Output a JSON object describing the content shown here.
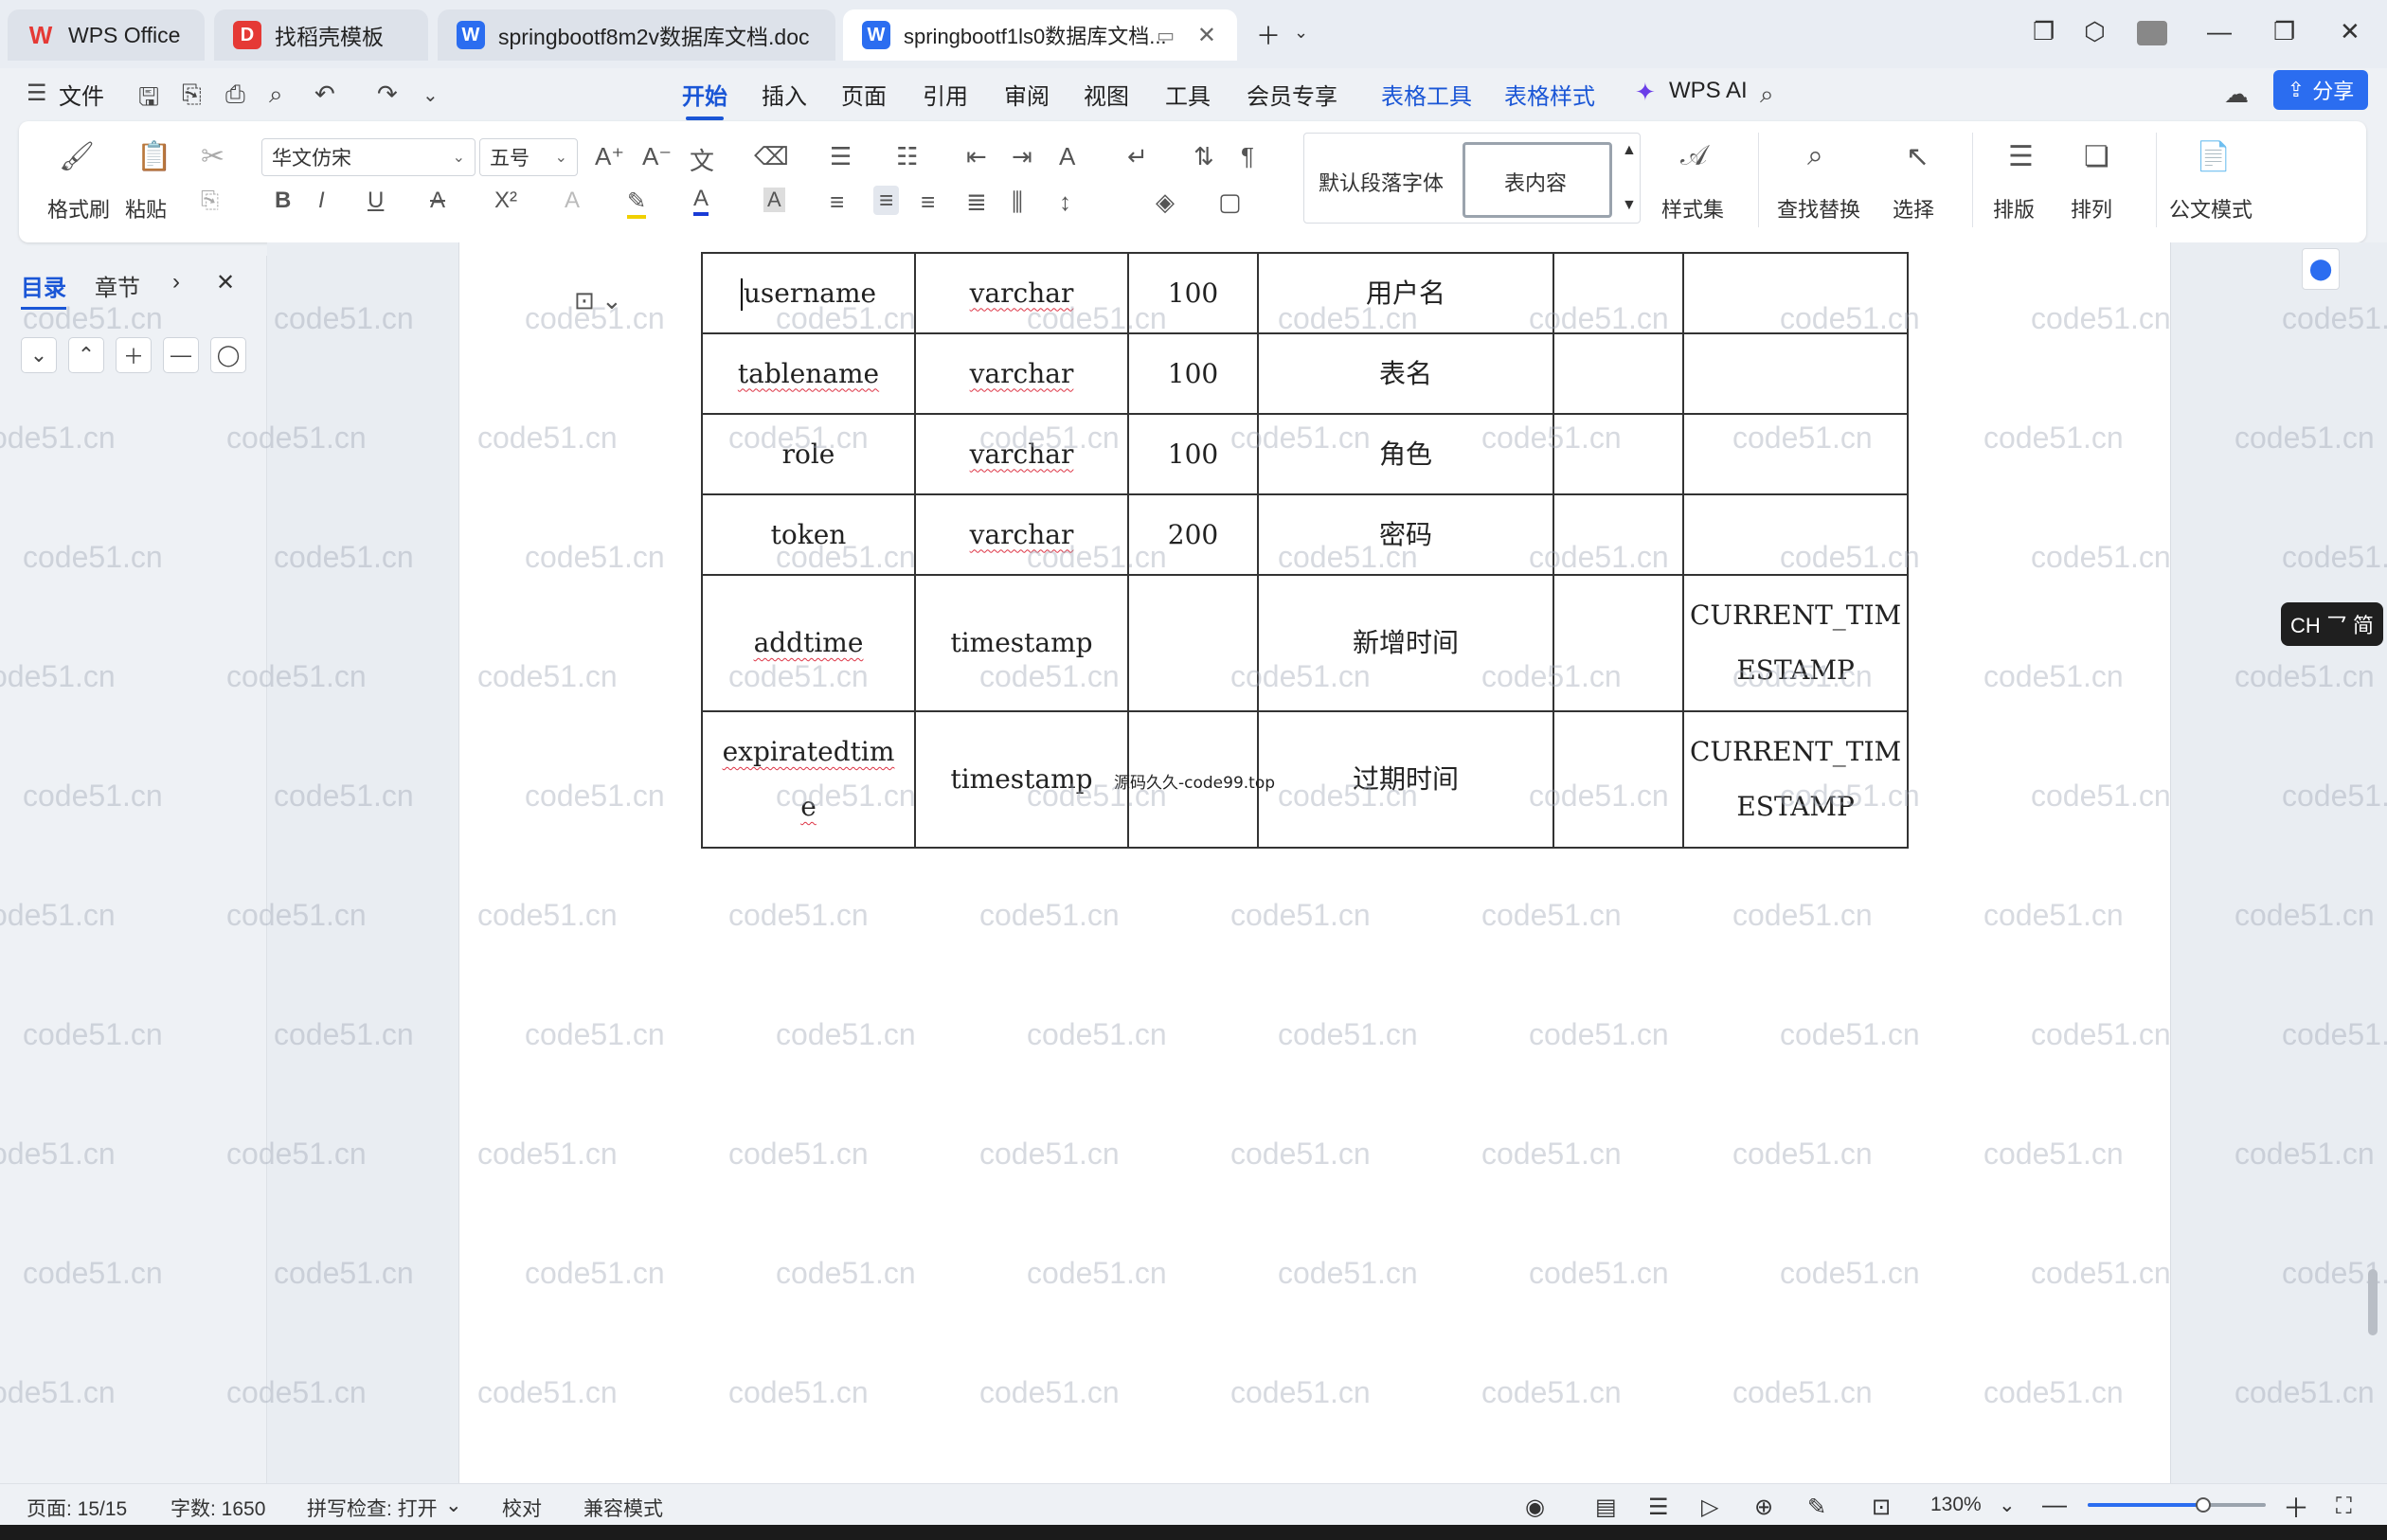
{
  "tabs": [
    {
      "label": "WPS Office",
      "logo": "W",
      "color": "#e53935"
    },
    {
      "label": "找稻壳模板",
      "logo": "D",
      "color": "#e53935"
    },
    {
      "label": "springbootf8m2v数据库文档.doc",
      "logo": "W",
      "color": "#2b6df0"
    },
    {
      "label": "springbootf1ls0数据库文档...",
      "logo": "W",
      "color": "#2b6df0"
    }
  ],
  "menu": {
    "file": "文件",
    "items": [
      "开始",
      "插入",
      "页面",
      "引用",
      "审阅",
      "视图",
      "工具",
      "会员专享",
      "表格工具",
      "表格样式",
      "WPS AI"
    ],
    "active": "开始",
    "share": "分享"
  },
  "ribbon": {
    "format_painter": "格式刷",
    "paste": "粘贴",
    "font": "华文仿宋",
    "font_size": "五号",
    "style_default": "默认段落字体",
    "style_current": "表内容",
    "style_set": "样式集",
    "find_replace": "查找替换",
    "select": "选择",
    "typeset": "排版",
    "arrange": "排列",
    "official_mode": "公文模式"
  },
  "nav": {
    "tab_toc": "目录",
    "tab_chapter": "章节"
  },
  "table": {
    "rows": [
      [
        "username",
        "varchar",
        "100",
        "用户名",
        "",
        ""
      ],
      [
        "tablename",
        "varchar",
        "100",
        "表名",
        "",
        ""
      ],
      [
        "role",
        "varchar",
        "100",
        "角色",
        "",
        ""
      ],
      [
        "token",
        "varchar",
        "200",
        "密码",
        "",
        ""
      ],
      [
        "addtime",
        "timestamp",
        "",
        "新增时间",
        "",
        "CURRENT_TIMESTAMP"
      ],
      [
        "expiratedtime",
        "timestamp",
        "",
        "过期时间",
        "",
        "CURRENT_TIMESTAMP"
      ]
    ],
    "cell_split": {
      "expiratedtime_line1": "expiratedtim",
      "expiratedtime_line2": "e",
      "current_line1": "CURRENT_TIM",
      "current_line2": "ESTAMP"
    }
  },
  "note": "源码久久-code99.top",
  "watermark": "code51.cn",
  "ime": "CH ⺂ 简",
  "status": {
    "page": "页面: 15/15",
    "words": "字数: 1650",
    "spell": "拼写检查: 打开",
    "proof": "校对",
    "compat": "兼容模式",
    "zoom": "130%",
    "zoom_level": 0.65
  }
}
